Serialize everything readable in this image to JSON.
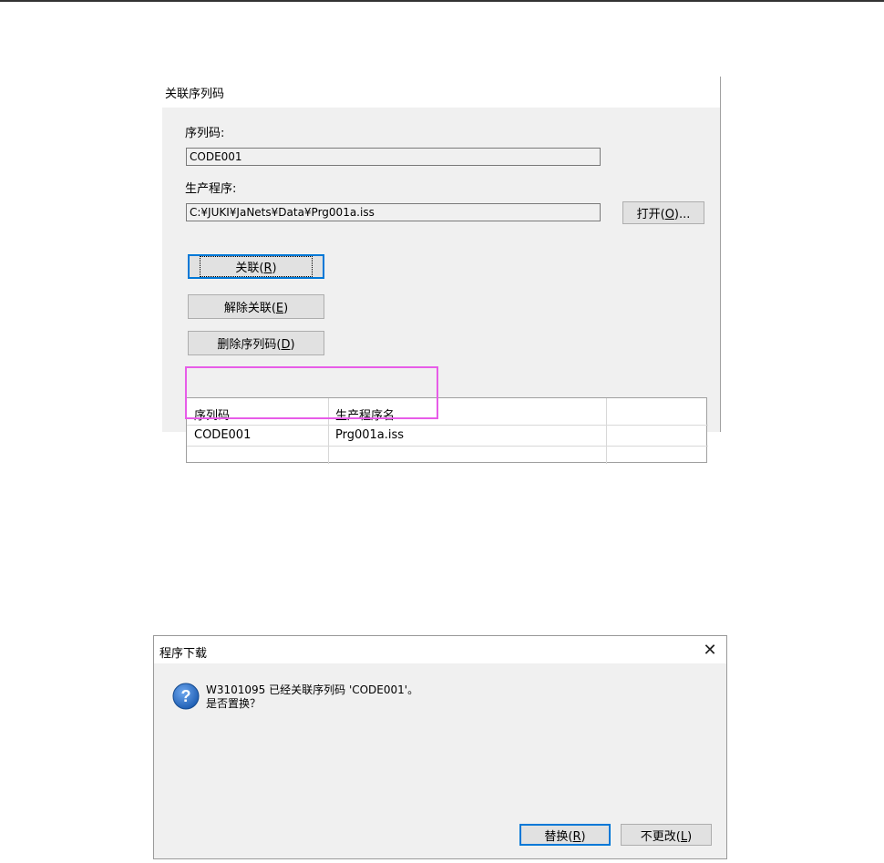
{
  "panel": {
    "title": "关联序列码",
    "serial_label": "序列码:",
    "serial_value": "CODE001",
    "program_label": "生产程序:",
    "program_value": "C:¥JUKI¥JaNets¥Data¥Prg001a.iss",
    "open_button": {
      "text": "打开(",
      "key": "O",
      "suffix": ")..."
    },
    "link_button": {
      "text": "关联(",
      "key": "R",
      "suffix": ")"
    },
    "unlink_button": {
      "text": "解除关联(",
      "key": "E",
      "suffix": ")"
    },
    "delete_button": {
      "text": "删除序列码(",
      "key": "D",
      "suffix": ")"
    },
    "table": {
      "headers": [
        "序列码",
        "生产程序名"
      ],
      "rows": [
        [
          "CODE001",
          "Prg001a.iss"
        ]
      ]
    }
  },
  "dialog": {
    "title": "程序下载",
    "close_glyph": "✕",
    "message_line1": "W3101095 已经关联序列码 'CODE001'。",
    "message_line2": "是否置换？",
    "replace_button": {
      "text": "替换(",
      "key": "R",
      "suffix": ")"
    },
    "keep_button": {
      "text": "不更改(",
      "key": "L",
      "suffix": ")"
    }
  },
  "colors": {
    "highlight": "#e75ce8",
    "focus": "#0078d7",
    "icon": "#1f5fb4"
  },
  "icons": {
    "dialog_icon": "question-icon"
  }
}
